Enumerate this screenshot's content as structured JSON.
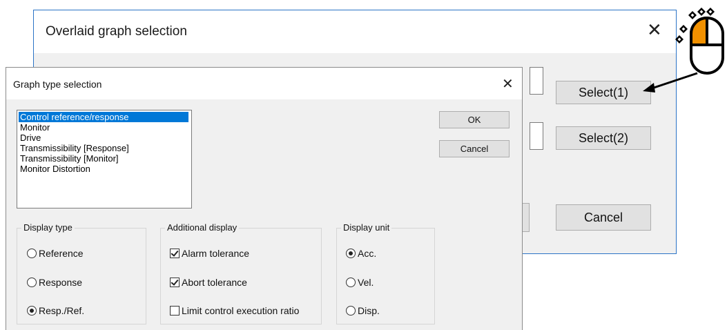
{
  "back_dialog": {
    "title": "Overlaid graph selection",
    "close_label": "✕",
    "select1_label": "Select(1)",
    "select2_label": "Select(2)",
    "cancel_label": "Cancel"
  },
  "front_dialog": {
    "title": "Graph type selection",
    "close_label": "✕",
    "list_items": [
      "Control reference/response",
      "Monitor",
      "Drive",
      "Transmissibility [Response]",
      "Transmissibility [Monitor]",
      "Monitor Distortion"
    ],
    "selected_item": "Control reference/response",
    "ok_label": "OK",
    "cancel_label": "Cancel",
    "display_type": {
      "label": "Display type",
      "options": [
        "Reference",
        "Response",
        "Resp./Ref."
      ],
      "selected": "Resp./Ref."
    },
    "additional_display": {
      "label": "Additional display",
      "options": [
        "Alarm tolerance",
        "Abort tolerance",
        "Limit control execution ratio"
      ],
      "checked": [
        true,
        true,
        false
      ]
    },
    "display_unit": {
      "label": "Display unit",
      "options": [
        "Acc.",
        "Vel.",
        "Disp."
      ],
      "selected": "Acc."
    }
  },
  "colors": {
    "selection": "#0078d7",
    "mouse_button_highlight": "#f29100",
    "window_border": "#2a73c6"
  },
  "icons": [
    "close-icon",
    "mouse-click-icon",
    "pointer-arrow-icon"
  ]
}
